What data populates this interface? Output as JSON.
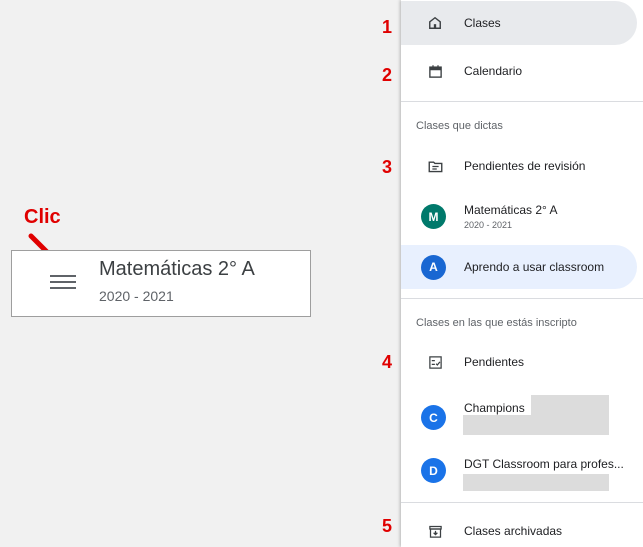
{
  "callout": {
    "label": "Clic",
    "label_color": "#e00000"
  },
  "class_card": {
    "title": "Matemáticas 2° A",
    "subtitle": "2020 - 2021",
    "menu_icon": "hamburger-menu-icon"
  },
  "steps": [
    "1",
    "2",
    "3",
    "4",
    "5"
  ],
  "drawer": {
    "home": {
      "label": "Clases",
      "icon": "home-icon"
    },
    "calendar": {
      "label": "Calendario",
      "icon": "calendar-icon"
    },
    "teaching_section": "Clases que dictas",
    "to_review": {
      "label": "Pendientes de revisión",
      "icon": "folder-review-icon"
    },
    "teaching_classes": [
      {
        "initial": "M",
        "name": "Matemáticas 2° A",
        "sub": "2020 - 2021",
        "color": "#00796b"
      },
      {
        "initial": "A",
        "name": "Aprendo a usar classroom",
        "sub": "",
        "color": "#1967d2"
      }
    ],
    "enrolled_section": "Clases en las que estás inscripto",
    "todo": {
      "label": "Pendientes",
      "icon": "checklist-icon"
    },
    "enrolled_classes": [
      {
        "initial": "C",
        "name": "Champions",
        "color": "#1a73e8"
      },
      {
        "initial": "D",
        "name": "DGT Classroom para profes...",
        "color": "#1a73e8"
      }
    ],
    "archived": {
      "label": "Clases archivadas",
      "icon": "archive-icon"
    }
  }
}
